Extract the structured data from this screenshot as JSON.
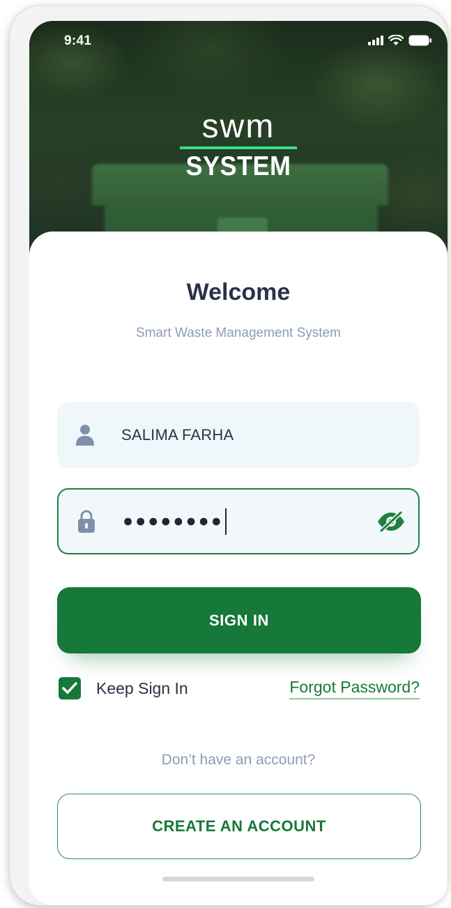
{
  "status_bar": {
    "time": "9:41"
  },
  "logo": {
    "top": "swm",
    "bottom": "SYSTEM"
  },
  "welcome": {
    "title": "Welcome",
    "subtitle": "Smart Waste Management System"
  },
  "form": {
    "username": {
      "value": "SALIMA FARHA",
      "icon": "user-icon"
    },
    "password": {
      "masked_value": "●●●●●●●●",
      "icon": "lock-icon",
      "toggle_icon": "eye-slash-icon"
    }
  },
  "actions": {
    "sign_in": "SIGN IN",
    "keep_signed_in": {
      "label": "Keep Sign In",
      "checked": true
    },
    "forgot_password": "Forgot Password?",
    "no_account": "Don’t have an account?",
    "create_account": "CREATE AN ACCOUNT"
  },
  "colors": {
    "primary": "#167839",
    "accent": "#3ddc84",
    "text_dark": "#2a3247",
    "text_muted": "#8e9cb4",
    "field_bg": "#f0f7fb"
  }
}
